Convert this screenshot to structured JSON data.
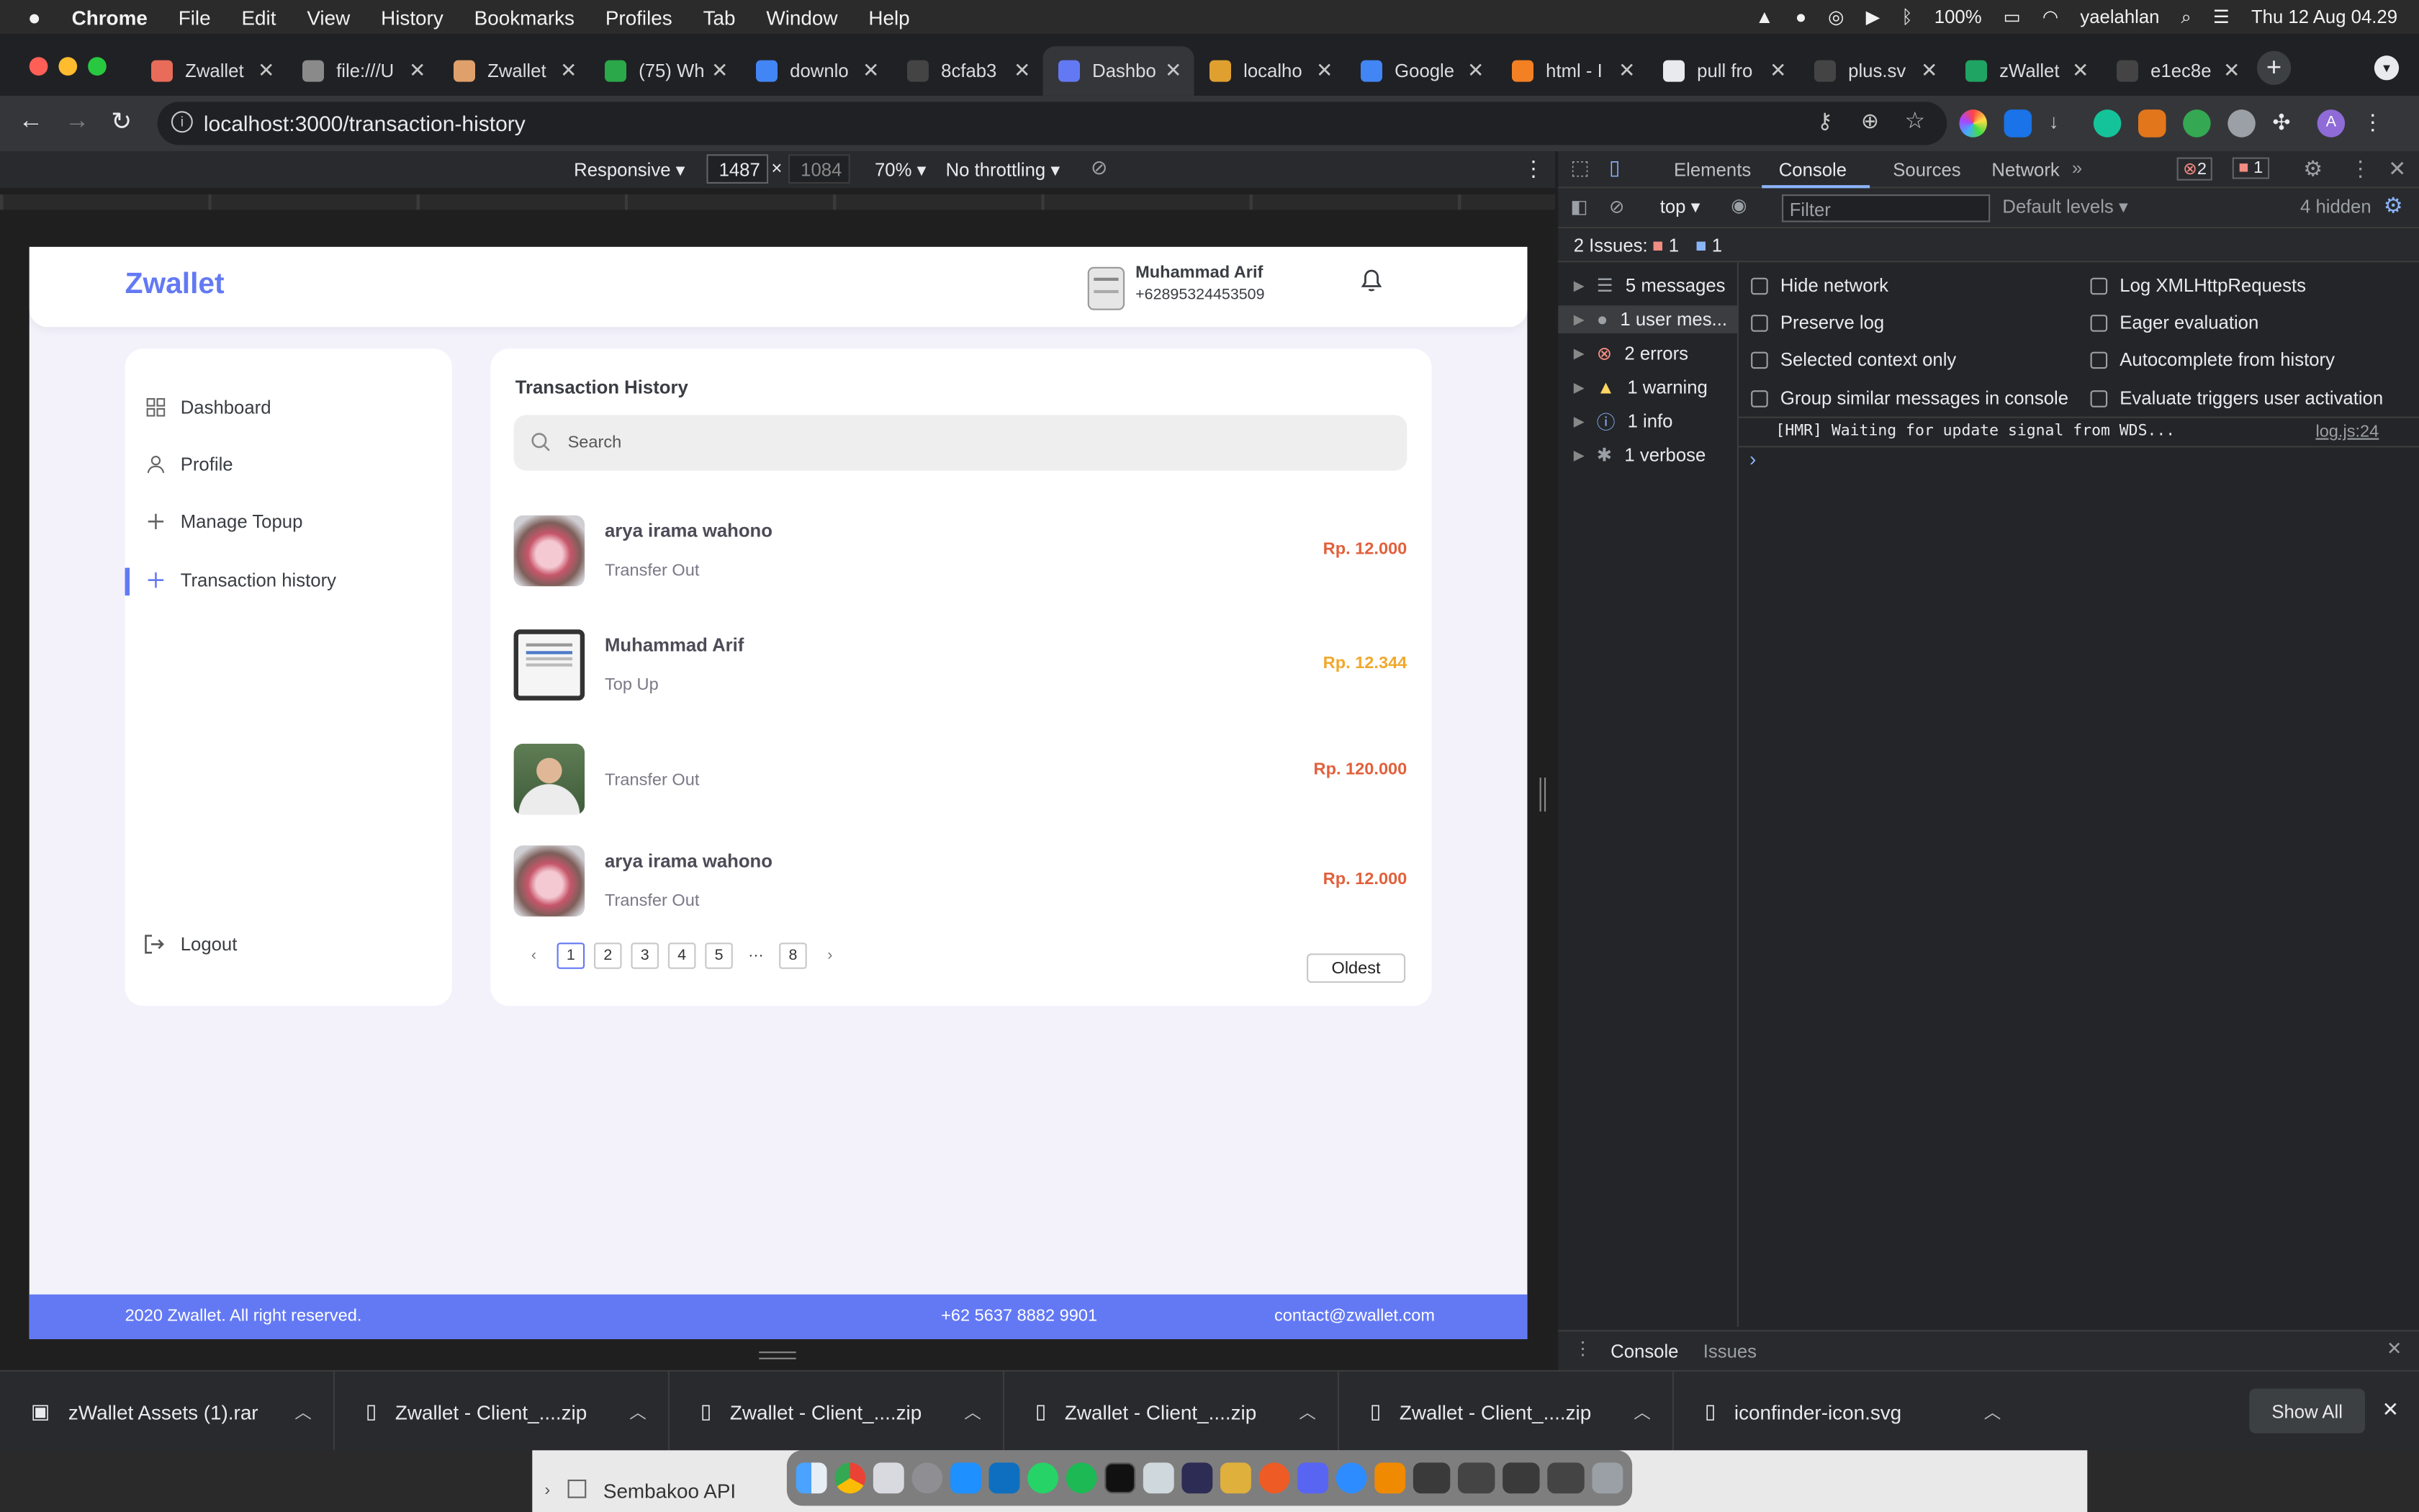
{
  "menubar": {
    "app": "Chrome",
    "items": [
      "File",
      "Edit",
      "View",
      "History",
      "Bookmarks",
      "Profiles",
      "Tab",
      "Window",
      "Help"
    ],
    "battery": "100%",
    "user": "yaelahlan",
    "datetime": "Thu 12 Aug  04.29"
  },
  "tabs": [
    {
      "title": "Zwallet",
      "color": "#e96b5a"
    },
    {
      "title": "file:///U",
      "color": "#8a8a8a"
    },
    {
      "title": "Zwallet",
      "color": "#e0a06b"
    },
    {
      "title": "(75) Wh",
      "color": "#2ba84a"
    },
    {
      "title": "downlo",
      "color": "#4285f4"
    },
    {
      "title": "8cfab3",
      "color": "#444444"
    },
    {
      "title": "Dashbo",
      "color": "#6379f4"
    },
    {
      "title": "localho",
      "color": "#e0a030"
    },
    {
      "title": "Google",
      "color": "#4285f4"
    },
    {
      "title": "html - I",
      "color": "#f48024"
    },
    {
      "title": "pull fro",
      "color": "#e8eaed"
    },
    {
      "title": "plus.sv",
      "color": "#444444"
    },
    {
      "title": "zWallet",
      "color": "#1fa463"
    },
    {
      "title": "e1ec8e",
      "color": "#444444"
    }
  ],
  "address": {
    "url": "localhost:3000/transaction-history"
  },
  "device_toolbar": {
    "mode": "Responsive",
    "width": "1487",
    "height": "1084",
    "zoom": "70%",
    "throttle": "No throttling"
  },
  "app": {
    "brand": "Zwallet",
    "user": {
      "name": "Muhammad Arif",
      "phone": "+62895324453509"
    },
    "nav": [
      {
        "label": "Dashboard",
        "icon": "grid-icon"
      },
      {
        "label": "Profile",
        "icon": "user-icon"
      },
      {
        "label": "Manage Topup",
        "icon": "plus-icon"
      },
      {
        "label": "Transaction history",
        "icon": "plus-icon"
      }
    ],
    "logout": "Logout",
    "main": {
      "title": "Transaction History",
      "search_placeholder": "Search",
      "transactions": [
        {
          "name": "arya irama wahono",
          "type": "Transfer Out",
          "amount": "Rp. 12.000",
          "color": "#e2603b"
        },
        {
          "name": "Muhammad Arif",
          "type": "Top Up",
          "amount": "Rp. 12.344",
          "color": "#f0a92c"
        },
        {
          "name": "",
          "type": "Transfer Out",
          "amount": "Rp. 120.000",
          "color": "#e2603b"
        },
        {
          "name": "arya irama wahono",
          "type": "Transfer Out",
          "amount": "Rp. 12.000",
          "color": "#e2603b"
        }
      ],
      "pagination": {
        "prev": "‹",
        "pages": [
          "1",
          "2",
          "3",
          "4",
          "5"
        ],
        "ellipsis": "···",
        "last": "8",
        "next": "›"
      },
      "sort": "Oldest"
    },
    "footer": {
      "copyright": "2020 Zwallet. All right reserved.",
      "phone": "+62 5637 8882 9901",
      "email": "contact@zwallet.com"
    }
  },
  "devtools": {
    "tabs": [
      "Elements",
      "Console",
      "Sources",
      "Network"
    ],
    "error_count": "2",
    "issue_count": "1",
    "context": "top",
    "filter_placeholder": "Filter",
    "levels": "Default levels",
    "hidden": "4 hidden",
    "issues_label": "2 Issues:",
    "issues_err": "1",
    "issues_info": "1",
    "sidebar": [
      "5 messages",
      "1 user mes...",
      "2 errors",
      "1 warning",
      "1 info",
      "1 verbose"
    ],
    "checkboxes_left": [
      "Hide network",
      "Preserve log",
      "Selected context only",
      "Group similar messages in console"
    ],
    "checkboxes_right": [
      "Log XMLHttpRequests",
      "Eager evaluation",
      "Autocomplete from history",
      "Evaluate triggers user activation"
    ],
    "log_message": "[HMR] Waiting for update signal from WDS...",
    "log_source": "log.js:24",
    "prompt": "›",
    "bottom_tabs": [
      "Console",
      "Issues"
    ]
  },
  "downloads": {
    "items": [
      "zWallet Assets (1).rar",
      "Zwallet - Client_....zip",
      "Zwallet - Client_....zip",
      "Zwallet - Client_....zip",
      "Zwallet - Client_....zip",
      "iconfinder-icon.svg"
    ],
    "show_all": "Show All"
  },
  "behind_window": {
    "title": "Sembakoo API"
  }
}
